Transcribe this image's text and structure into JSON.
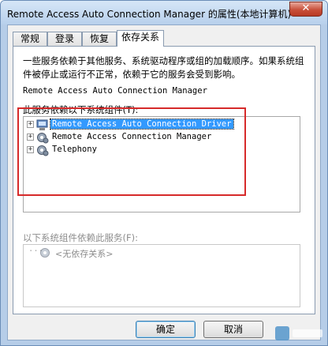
{
  "window": {
    "title": "Remote Access Auto Connection Manager 的属性(本地计算机)",
    "close_label": "✕"
  },
  "tabs": [
    {
      "label": "常规"
    },
    {
      "label": "登录"
    },
    {
      "label": "恢复"
    },
    {
      "label": "依存关系"
    }
  ],
  "panel": {
    "description": "一些服务依赖于其他服务、系统驱动程序或组的加载顺序。如果系统组件被停止或运行不正常，依赖于它的服务会受到影响。",
    "service_name": "Remote Access Auto Connection Manager",
    "depends_on_label": "此服务依赖以下系统组件(T):",
    "depends_on_items": [
      {
        "label": "Remote Access Auto Connection Driver",
        "icon": "driver-icon"
      },
      {
        "label": "Remote Access Connection Manager",
        "icon": "gear-icon"
      },
      {
        "label": "Telephony",
        "icon": "gear-icon"
      }
    ],
    "dependents_label": "以下系统组件依赖此服务(F):",
    "dependents_items": [
      {
        "label": "<无依存关系>",
        "icon": "gear-icon"
      }
    ]
  },
  "buttons": {
    "ok_label": "确定",
    "cancel_label": "取消"
  },
  "colors": {
    "highlight_border": "#d62a2a",
    "selection": "#3399ff"
  }
}
